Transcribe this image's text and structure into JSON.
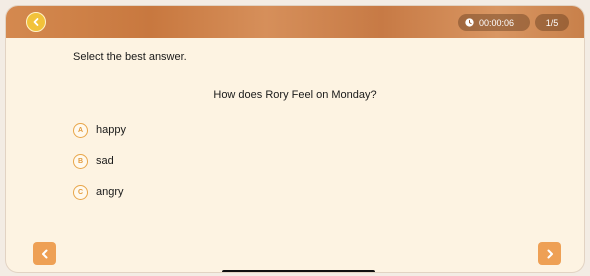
{
  "header": {
    "timer": "00:00:06",
    "progress": "1/5"
  },
  "quiz": {
    "instruction": "Select the best answer.",
    "question": "How does Rory Feel on Monday?",
    "options": [
      {
        "letter": "A",
        "text": "happy"
      },
      {
        "letter": "B",
        "text": "sad"
      },
      {
        "letter": "C",
        "text": "angry"
      }
    ]
  },
  "icons": {
    "back": "chevron-left-icon",
    "clock": "clock-icon",
    "prev": "chevron-left-icon",
    "next": "chevron-right-icon"
  },
  "colors": {
    "accent": "#eea055",
    "option_border": "#e8a64a",
    "back_button": "#f2c23a",
    "background": "#fdf3e2"
  }
}
